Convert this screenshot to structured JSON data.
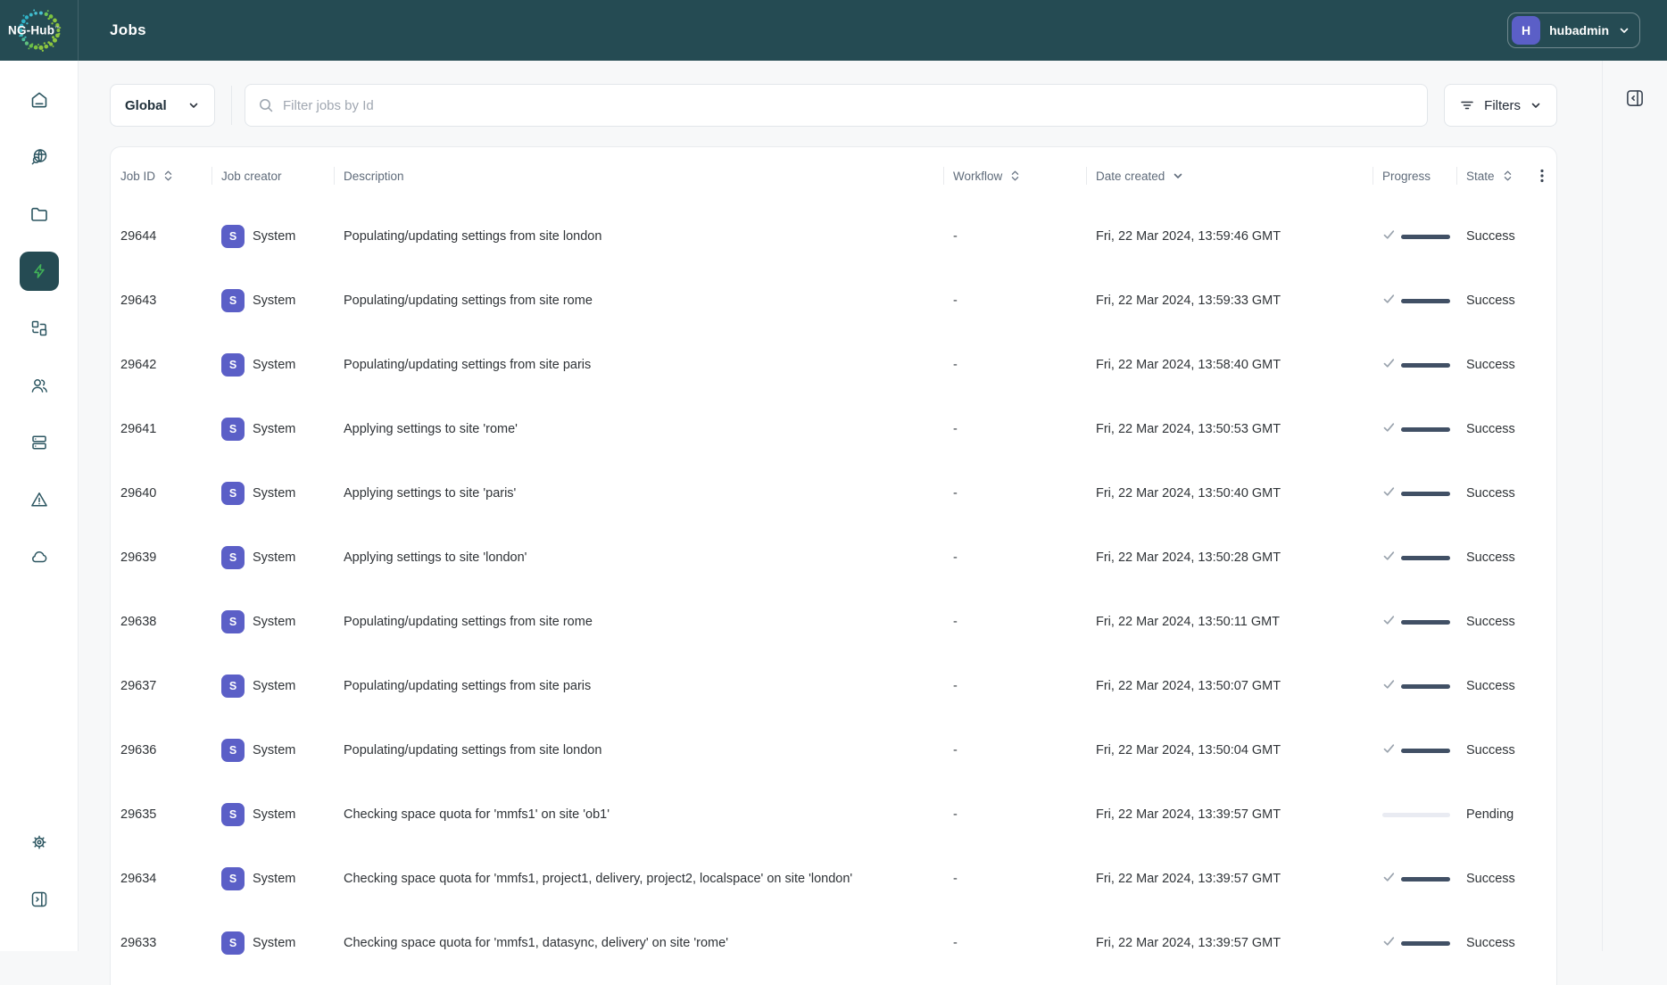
{
  "app": {
    "logo": "NG-Hub",
    "title": "Jobs"
  },
  "user": {
    "initial": "H",
    "name": "hubadmin"
  },
  "colors": {
    "header_bg": "#254b53",
    "accent_green": "#41b058",
    "avatar_indigo": "#5b5fc7",
    "progress_fill": "#415065",
    "progress_track": "#e9ebf2",
    "logo_cyan": "#2fb4c9",
    "logo_green": "#8dc63f"
  },
  "sidebar": {
    "icons": [
      "home-icon",
      "globe-search-icon",
      "folder-icon",
      "jobs-lightning-icon",
      "resources-icon",
      "users-icon",
      "servers-icon",
      "alerts-icon",
      "cloud-icon",
      "settings-gear-icon",
      "expand-panel-icon"
    ],
    "active_index": 3
  },
  "toolbar": {
    "scope": "Global",
    "search_placeholder": "Filter jobs by Id",
    "search_value": "",
    "filters_label": "Filters"
  },
  "table": {
    "columns": [
      {
        "label": "Job ID",
        "sort": "both"
      },
      {
        "label": "Job creator",
        "sort": "none"
      },
      {
        "label": "Description",
        "sort": "none"
      },
      {
        "label": "Workflow",
        "sort": "both"
      },
      {
        "label": "Date created",
        "sort": "desc"
      },
      {
        "label": "Progress",
        "sort": "none"
      },
      {
        "label": "State",
        "sort": "both"
      }
    ],
    "rows": [
      {
        "id": "29644",
        "creator": "System",
        "initial": "S",
        "description": "Populating/updating settings from site london",
        "workflow": "-",
        "date": "Fri, 22 Mar 2024, 13:59:46 GMT",
        "state": "Success"
      },
      {
        "id": "29643",
        "creator": "System",
        "initial": "S",
        "description": "Populating/updating settings from site rome",
        "workflow": "-",
        "date": "Fri, 22 Mar 2024, 13:59:33 GMT",
        "state": "Success"
      },
      {
        "id": "29642",
        "creator": "System",
        "initial": "S",
        "description": "Populating/updating settings from site paris",
        "workflow": "-",
        "date": "Fri, 22 Mar 2024, 13:58:40 GMT",
        "state": "Success"
      },
      {
        "id": "29641",
        "creator": "System",
        "initial": "S",
        "description": "Applying settings to site 'rome'",
        "workflow": "-",
        "date": "Fri, 22 Mar 2024, 13:50:53 GMT",
        "state": "Success"
      },
      {
        "id": "29640",
        "creator": "System",
        "initial": "S",
        "description": "Applying settings to site 'paris'",
        "workflow": "-",
        "date": "Fri, 22 Mar 2024, 13:50:40 GMT",
        "state": "Success"
      },
      {
        "id": "29639",
        "creator": "System",
        "initial": "S",
        "description": "Applying settings to site 'london'",
        "workflow": "-",
        "date": "Fri, 22 Mar 2024, 13:50:28 GMT",
        "state": "Success"
      },
      {
        "id": "29638",
        "creator": "System",
        "initial": "S",
        "description": "Populating/updating settings from site rome",
        "workflow": "-",
        "date": "Fri, 22 Mar 2024, 13:50:11 GMT",
        "state": "Success"
      },
      {
        "id": "29637",
        "creator": "System",
        "initial": "S",
        "description": "Populating/updating settings from site paris",
        "workflow": "-",
        "date": "Fri, 22 Mar 2024, 13:50:07 GMT",
        "state": "Success"
      },
      {
        "id": "29636",
        "creator": "System",
        "initial": "S",
        "description": "Populating/updating settings from site london",
        "workflow": "-",
        "date": "Fri, 22 Mar 2024, 13:50:04 GMT",
        "state": "Success"
      },
      {
        "id": "29635",
        "creator": "System",
        "initial": "S",
        "description": "Checking space quota for 'mmfs1' on site 'ob1'",
        "workflow": "-",
        "date": "Fri, 22 Mar 2024, 13:39:57 GMT",
        "state": "Pending"
      },
      {
        "id": "29634",
        "creator": "System",
        "initial": "S",
        "description": "Checking space quota for 'mmfs1, project1, delivery, project2, localspace' on site 'london'",
        "workflow": "-",
        "date": "Fri, 22 Mar 2024, 13:39:57 GMT",
        "state": "Success"
      },
      {
        "id": "29633",
        "creator": "System",
        "initial": "S",
        "description": "Checking space quota for 'mmfs1, datasync, delivery' on site 'rome'",
        "workflow": "-",
        "date": "Fri, 22 Mar 2024, 13:39:57 GMT",
        "state": "Success"
      }
    ]
  }
}
